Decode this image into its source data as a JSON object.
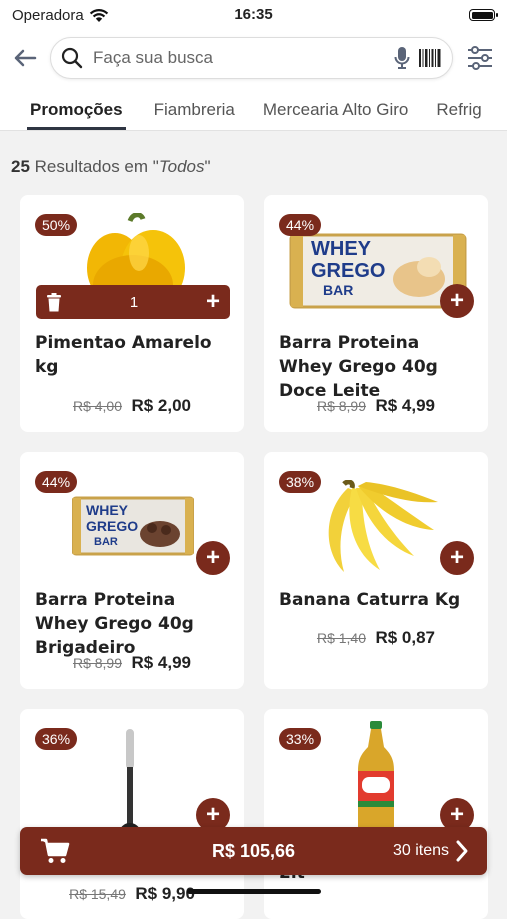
{
  "status": {
    "carrier": "Operadora",
    "time": "16:35"
  },
  "search": {
    "placeholder": "Faça sua busca"
  },
  "tabs": [
    "Promoções",
    "Fiambreria",
    "Mercearia Alto Giro",
    "Refrig"
  ],
  "results": {
    "count": "25",
    "text": "Resultados em \"",
    "scope": "Todos",
    "end": "\""
  },
  "products": [
    {
      "discount": "50%",
      "name": "Pimentao Amarelo kg",
      "old_price": "R$ 4,00",
      "price": "R$ 2,00",
      "qty": "1",
      "image": "yellow-pepper"
    },
    {
      "discount": "44%",
      "name": "Barra Proteina Whey Grego 40g Doce Leite",
      "old_price": "R$ 8,99",
      "price": "R$ 4,99",
      "image": "whey-bar-doce-leite"
    },
    {
      "discount": "44%",
      "name": "Barra Proteina Whey Grego 40g Brigadeiro",
      "old_price": "R$ 8,99",
      "price": "R$ 4,99",
      "image": "whey-bar-brigadeiro"
    },
    {
      "discount": "38%",
      "name": "Banana Caturra Kg",
      "old_price": "R$ 1,40",
      "price": "R$ 0,87",
      "image": "banana"
    },
    {
      "discount": "36%",
      "name": "",
      "old_price": "R$ 15,49",
      "price": "R$ 9,90",
      "image": "ladle"
    },
    {
      "discount": "33%",
      "name": "2lt",
      "image": "soda-bottle"
    }
  ],
  "whey_label": {
    "line1": "WHEY",
    "line2": "GREGO",
    "line3": "BAR"
  },
  "cart": {
    "total": "R$ 105,66",
    "items": "30 itens"
  },
  "colors": {
    "accent": "#7a2a1c",
    "background": "#f2f2f2"
  }
}
